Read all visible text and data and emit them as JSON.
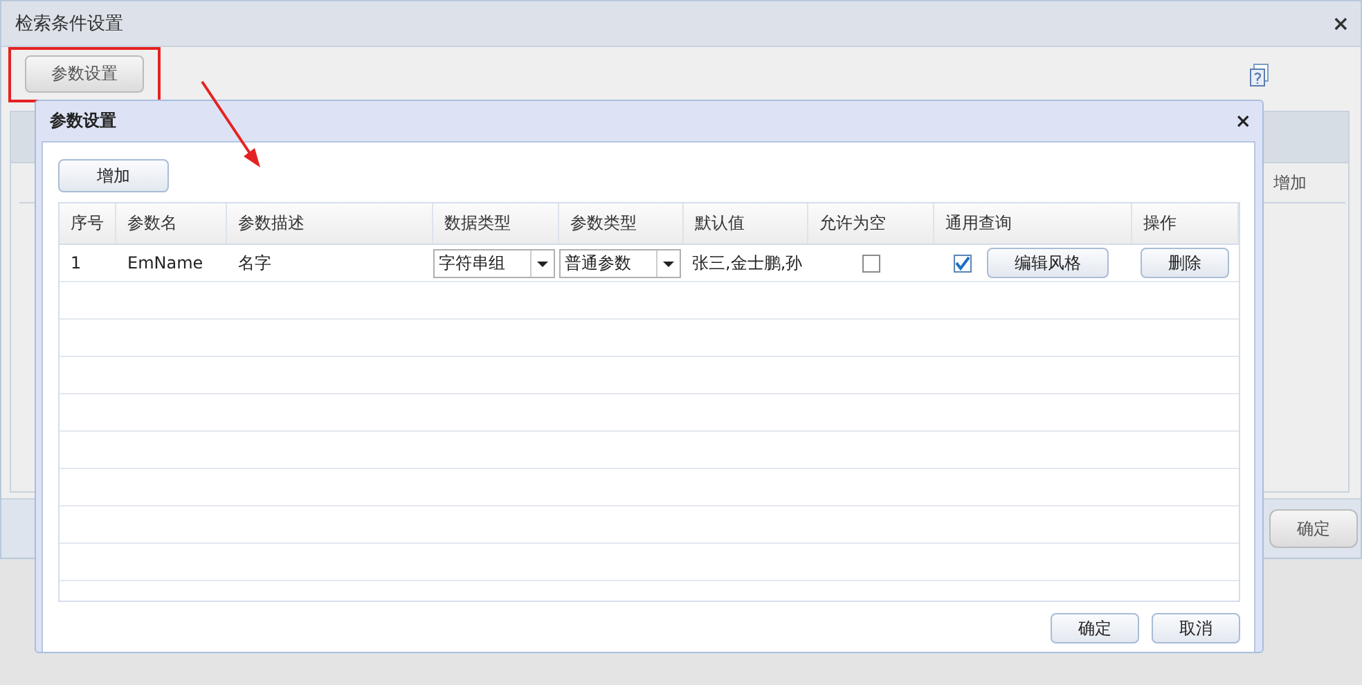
{
  "window": {
    "title": "检索条件设置",
    "close": "×"
  },
  "toolbar": {
    "button": "参数设置",
    "highlighted": true
  },
  "background": {
    "partial_text": "增加",
    "ok_button": "确定"
  },
  "dialog": {
    "title": "参数设置",
    "close": "×",
    "add_button": "增加",
    "columns": [
      "序号",
      "参数名",
      "参数描述",
      "数据类型",
      "参数类型",
      "默认值",
      "允许为空",
      "通用查询",
      "操作"
    ],
    "rows": [
      {
        "index": "1",
        "name": "EmName",
        "description": "名字",
        "data_type": "字符串组",
        "param_type": "普通参数",
        "default": "张三,金士鹏,孙",
        "allow_null": false,
        "general_query": true,
        "style_button": "编辑风格",
        "delete_button": "删除"
      }
    ],
    "ok_button": "确定",
    "cancel_button": "取消"
  }
}
